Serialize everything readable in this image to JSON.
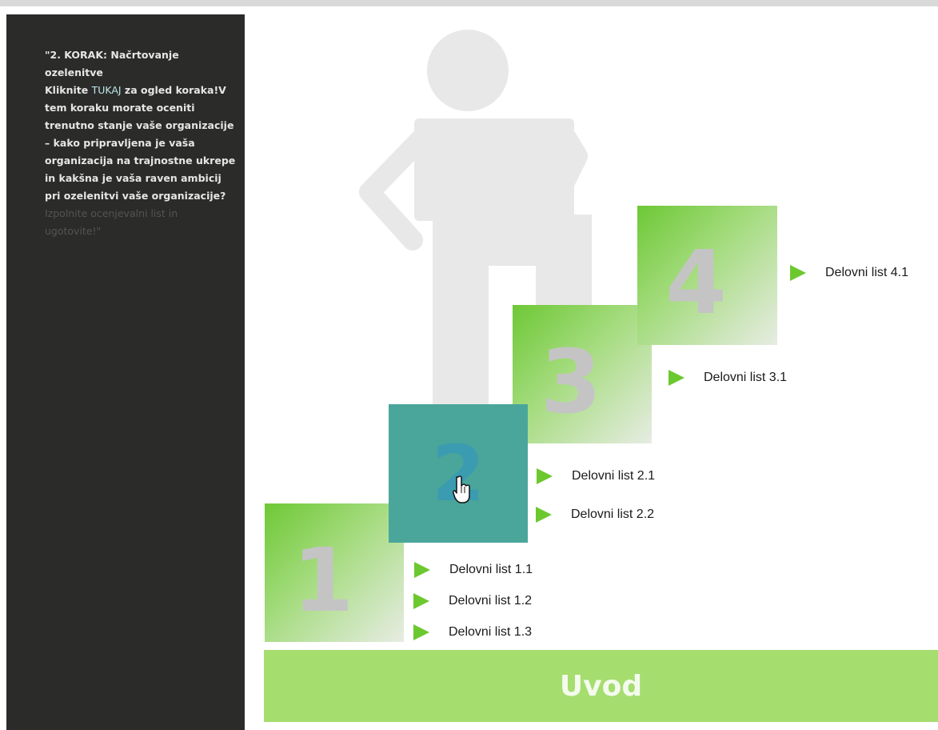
{
  "panel": {
    "line1": "\"2. KORAK: Načrtovanje ozelenitve",
    "line2_pre": "Kliknite ",
    "line2_link": "TUKAJ",
    "line2_post": " za ogled koraka!V",
    "body": "tem koraku morate oceniti trenutno stanje vaše organizacije – kako pripravljena je vaša organizacija na trajnostne ukrepe in kakšna je vaša raven ambicij pri ozelenitvi vaše organizacije?",
    "faded": "Izpolnite ocenjevalni list in ugotovite!\""
  },
  "steps": {
    "s1": "1",
    "s2": "2",
    "s3": "3",
    "s4": "4"
  },
  "links": {
    "l11": "Delovni list 1.1",
    "l12": "Delovni list 1.2",
    "l13": "Delovni list 1.3",
    "l21": "Delovni list 2.1",
    "l22": "Delovni list 2.2",
    "l31": "Delovni list 3.1",
    "l41": "Delovni list 4.1"
  },
  "base": {
    "label": "Uvod"
  },
  "colors": {
    "panel": "#2b2b29",
    "accent_green": "#6cc82f",
    "active_step": "#4aa69b",
    "base_bar": "#a6dd6f"
  },
  "icons": [
    "play-arrow-icon",
    "hand-pointer-icon",
    "person-figure"
  ]
}
